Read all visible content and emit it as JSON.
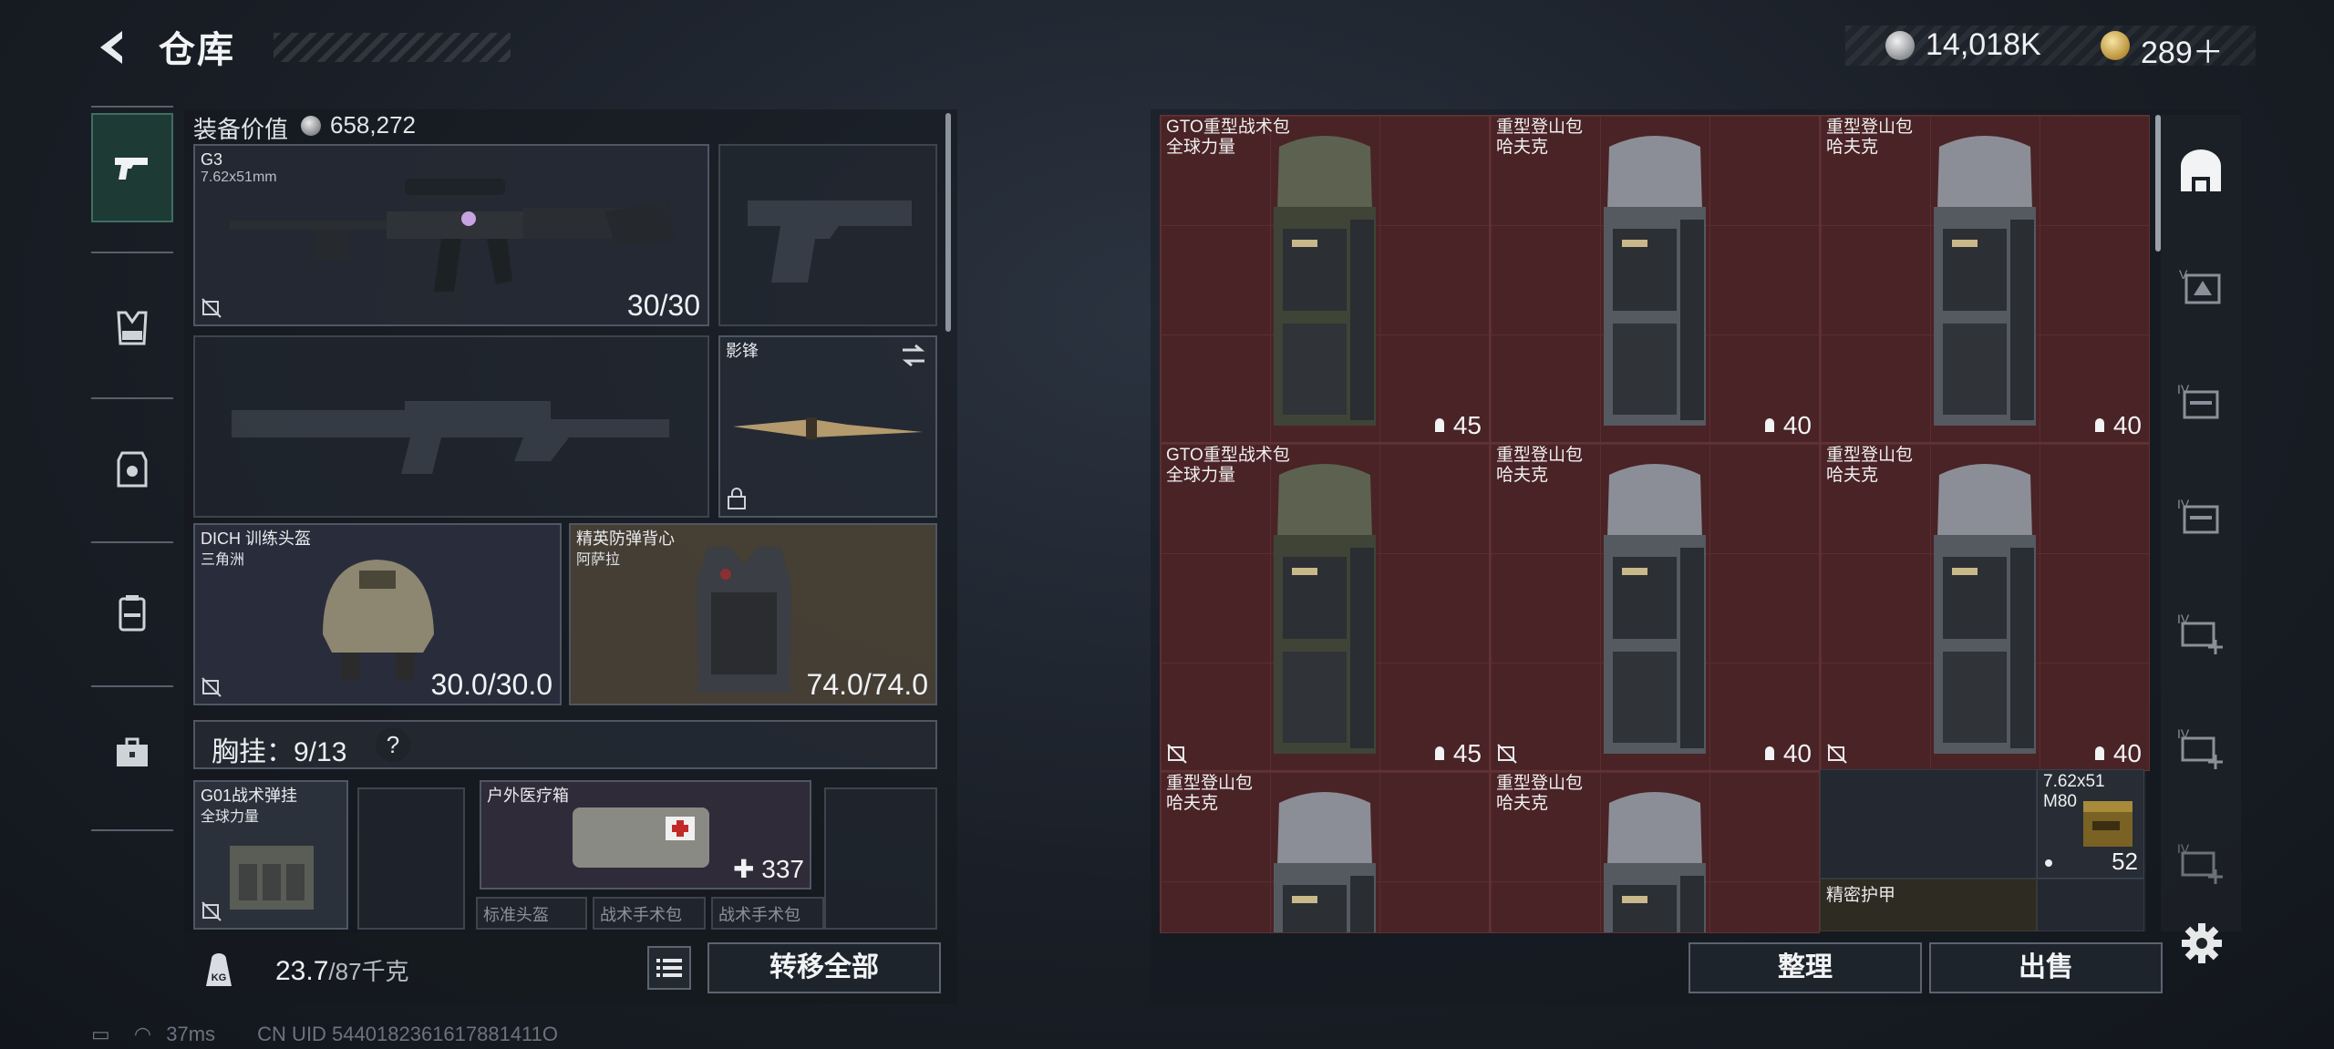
{
  "header": {
    "title": "仓库",
    "currency": [
      {
        "icon": "silver-coin-icon",
        "value": "14,018K"
      },
      {
        "icon": "gold-coin-icon",
        "value": "289＋"
      }
    ]
  },
  "rail": {
    "tabs": [
      {
        "name": "weapons",
        "icon": "pistol-icon",
        "active": true
      },
      {
        "name": "rig",
        "icon": "chest-rig-icon",
        "active": false
      },
      {
        "name": "armor",
        "icon": "armor-vest-icon",
        "active": false
      },
      {
        "name": "backpack",
        "icon": "backpack-icon",
        "active": false
      },
      {
        "name": "case",
        "icon": "toolcase-icon",
        "active": false
      }
    ]
  },
  "loadout": {
    "value_label": "装备价值",
    "value": "658,272",
    "primary": {
      "name": "G3",
      "caliber": "7.62x51mm",
      "ammo": "30/30"
    },
    "melee": {
      "name": "影锋"
    },
    "helmet": {
      "name": "DICH 训练头盔",
      "maker": "三角洲",
      "durability": "30.0/30.0"
    },
    "vest": {
      "name": "精英防弹背心",
      "maker": "阿萨拉",
      "durability": "74.0/74.0"
    },
    "chest_rig": {
      "label": "胸挂：",
      "capacity": "9/13",
      "help": "?"
    },
    "rig_item": {
      "name": "G01战术弹挂",
      "maker": "全球力量"
    },
    "medkit": {
      "name": "户外医疗箱",
      "uses": "337"
    },
    "placeholders": [
      "标准头盔",
      "战术手术包",
      "战术手术包"
    ],
    "weight": {
      "current": "23.7",
      "max": "/87千克"
    },
    "transfer_all": "转移全部"
  },
  "stash": {
    "items": [
      {
        "name": "GTO重型战术包",
        "maker": "全球力量",
        "capacity": "45",
        "color": "green",
        "no_insure": false
      },
      {
        "name": "重型登山包",
        "maker": "哈夫克",
        "capacity": "40",
        "color": "gray",
        "no_insure": false
      },
      {
        "name": "重型登山包",
        "maker": "哈夫克",
        "capacity": "40",
        "color": "gray",
        "no_insure": false
      },
      {
        "name": "GTO重型战术包",
        "maker": "全球力量",
        "capacity": "45",
        "color": "green",
        "no_insure": true
      },
      {
        "name": "重型登山包",
        "maker": "哈夫克",
        "capacity": "40",
        "color": "gray",
        "no_insure": true
      },
      {
        "name": "重型登山包",
        "maker": "哈夫克",
        "capacity": "40",
        "color": "gray",
        "no_insure": true
      },
      {
        "name": "重型登山包",
        "maker": "哈夫克",
        "capacity": "",
        "color": "gray",
        "no_insure": false
      },
      {
        "name": "重型登山包",
        "maker": "哈夫克",
        "capacity": "",
        "color": "gray",
        "no_insure": false
      }
    ],
    "ammo": {
      "name": "7.62x51",
      "type": "M80",
      "count": "52"
    },
    "armor_label": "精密护甲",
    "sort_label": "整理",
    "sell_label": "出售"
  },
  "status": {
    "ping": "37ms",
    "uid": "CN UID 5440182361617881411O"
  },
  "colors": {
    "stash_cell": "#4a2326",
    "active_tab": "#1e3a35"
  }
}
